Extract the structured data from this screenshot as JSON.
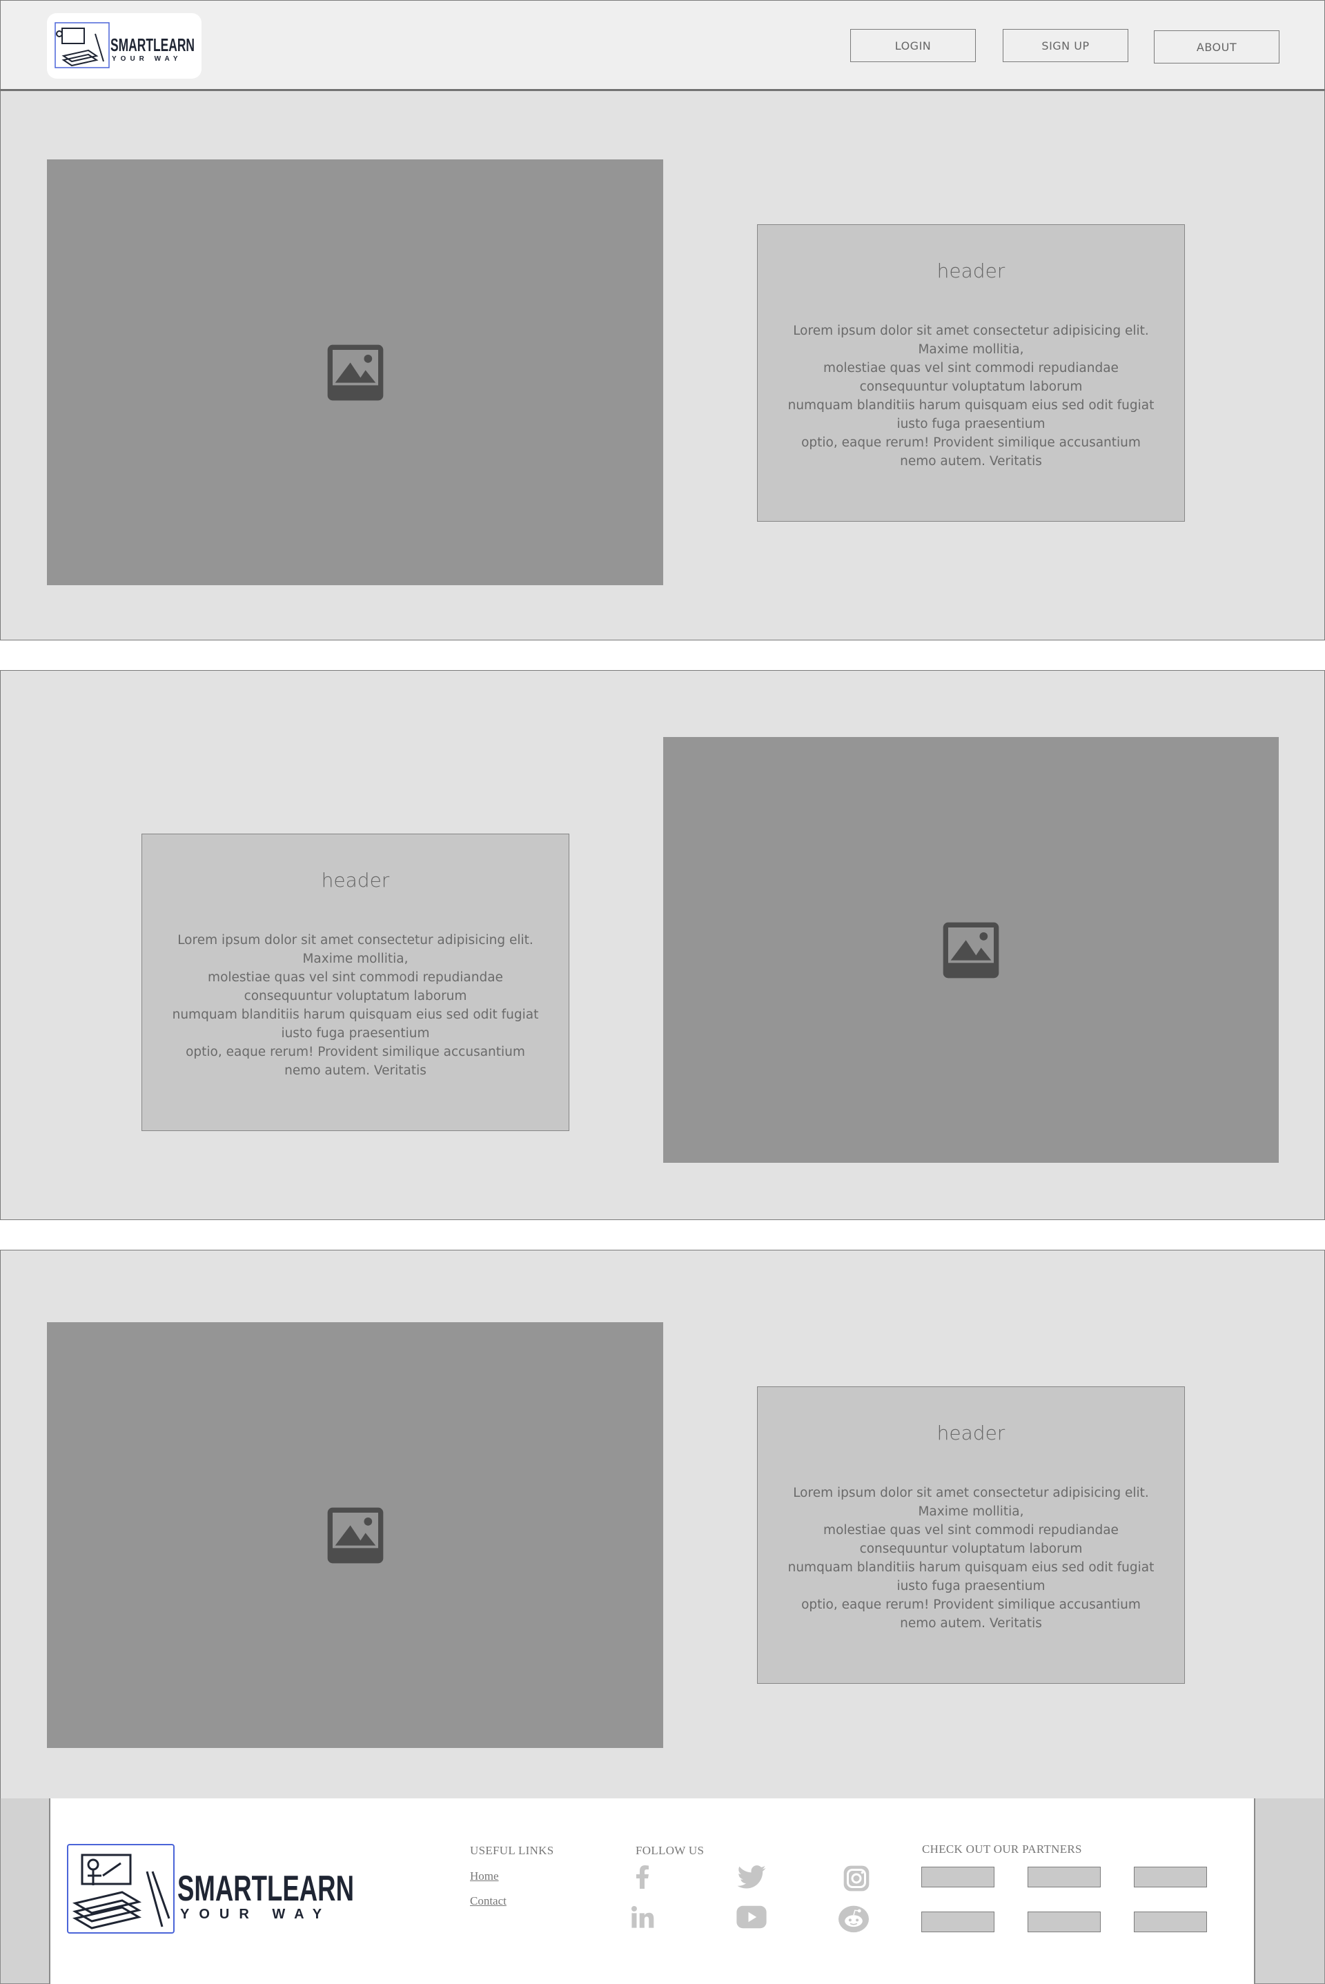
{
  "nav": {
    "logo": {
      "brand": "SMARTLEARN",
      "tagline": "YOUR WAY"
    },
    "login_label": "LOGIN",
    "signup_label": "SIGN UP",
    "about_label": "ABOUT"
  },
  "sections": [
    {
      "header": "header",
      "body": "Lorem ipsum dolor sit amet consectetur adipisicing elit. Maxime mollitia,\nmolestiae quas vel sint commodi repudiandae consequuntur voluptatum laborum\nnumquam blanditiis harum quisquam eius sed odit fugiat iusto fuga praesentium\noptio, eaque rerum! Provident similique accusantium nemo autem. Veritatis",
      "image_icon": "image-icon"
    },
    {
      "header": "header",
      "body": "Lorem ipsum dolor sit amet consectetur adipisicing elit. Maxime mollitia,\nmolestiae quas vel sint commodi repudiandae consequuntur voluptatum laborum\nnumquam blanditiis harum quisquam eius sed odit fugiat iusto fuga praesentium\noptio, eaque rerum! Provident similique accusantium nemo autem. Veritatis",
      "image_icon": "image-icon"
    },
    {
      "header": "header",
      "body": "Lorem ipsum dolor sit amet consectetur adipisicing elit. Maxime mollitia,\nmolestiae quas vel sint commodi repudiandae consequuntur voluptatum laborum\nnumquam blanditiis harum quisquam eius sed odit fugiat iusto fuga praesentium\noptio, eaque rerum! Provident similique accusantium nemo autem. Veritatis",
      "image_icon": "image-icon"
    }
  ],
  "footer": {
    "logo": {
      "brand": "SMARTLEARN",
      "tagline": "YOUR WAY"
    },
    "useful_links_heading": "USEFUL LINKS",
    "useful_links": [
      "Home",
      "Contact"
    ],
    "follow_us_heading": "FOLLOW US",
    "social_icons": [
      "facebook-icon",
      "twitter-icon",
      "instagram-icon",
      "linkedin-icon",
      "youtube-icon",
      "reddit-icon"
    ],
    "partners_heading": "CHECK OUT OUR PARTNERS",
    "partner_count": 6
  },
  "colors": {
    "nav_bg": "#efefef",
    "section_bg": "#e2e2e2",
    "image_placeholder": "#959595",
    "card_bg": "#c7c7c7",
    "logo_accent": "#4a64d8",
    "logo_text": "#1f2533"
  }
}
